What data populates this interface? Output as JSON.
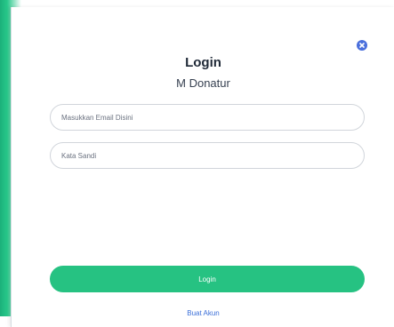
{
  "modal": {
    "title": "Login",
    "subtitle": "M Donatur",
    "email_placeholder": "Masukkan Email Disini",
    "password_placeholder": "Kata Sandi",
    "login_label": "Login",
    "signup_label": "Buat Akun",
    "close_icon": "close-circle-icon"
  },
  "colors": {
    "primary_green": "#26c282",
    "close_blue": "#4a6fdc",
    "link_blue": "#3b6fd8"
  }
}
